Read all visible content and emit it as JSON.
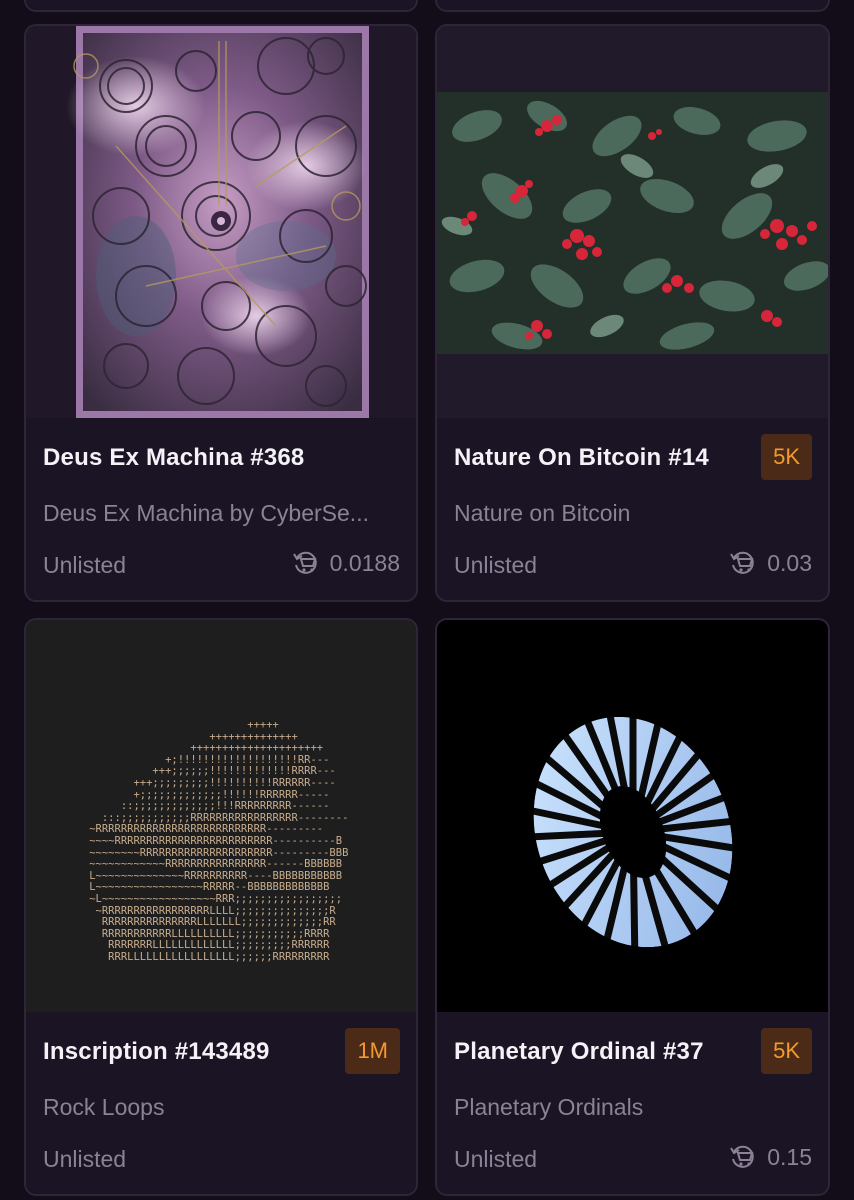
{
  "cards": [
    {
      "title": "Deus Ex Machina #368",
      "subtitle": "Deus Ex Machina by CyberSe...",
      "status": "Unlisted",
      "price": "0.0188",
      "badge": null,
      "image_icon": "steampunk-gears-artwork"
    },
    {
      "title": "Nature On Bitcoin #14",
      "subtitle": "Nature on Bitcoin",
      "status": "Unlisted",
      "price": "0.03",
      "badge": "5K",
      "image_icon": "red-flowers-foliage-artwork"
    },
    {
      "title": "Inscription #143489",
      "subtitle": "Rock Loops",
      "status": "Unlisted",
      "price": null,
      "badge": "1M",
      "image_icon": "ascii-art-artwork"
    },
    {
      "title": "Planetary Ordinal #37",
      "subtitle": "Planetary Ordinals",
      "status": "Unlisted",
      "price": "0.15",
      "badge": "5K",
      "image_icon": "striped-torus-artwork"
    }
  ],
  "colors": {
    "background": "#120d19",
    "card": "#1b1424",
    "badge_bg": "#4b2a17",
    "badge_text": "#f39a2d",
    "muted_text": "#8b8296"
  },
  "ascii_art": "                                   +++++\n                             ++++++++++++++\n                          +++++++++++++++++++++\n                      +;!!!!!!!!!!!!!!!!!!!RR---\n                    +++;;;;;;!!!!!!!!!!!!!RRRR---\n                 +++;;;;;;;;;!!!!!!!!!!RRRRRR----\n                 +;;;;;;;;;;;;;!!!!!!RRRRRR-----\n               ::;;;;;;;;;;;;;!!!RRRRRRRRR------\n            :::;;;;;;;;;;;RRRRRRRRRRRRRRRRR--------\n          ~RRRRRRRRRRRRRRRRRRRRRRRRRRR---------\n          ~~~~RRRRRRRRRRRRRRRRRRRRRRRRR----------B\n          ~~~~~~~~RRRRRRRRRRRRRRRRRRRRR---------BBB\n          ~~~~~~~~~~~~RRRRRRRRRRRRRRRR------BBBBBB\n          L~~~~~~~~~~~~~~RRRRRRRRRR----BBBBBBBBBBB\n          L~~~~~~~~~~~~~~~~~RRRRR--BBBBBBBBBBBBB\n          ~L~~~~~~~~~~~~~~~~~~RRR;;;;;;;;;;;;;;;;;\n           ~RRRRRRRRRRRRRRRRRLLLL;;;;;;;;;;;;;;;R\n            RRRRRRRRRRRRRRRLLLLLLL;;;;;;;;;;;;;RR\n            RRRRRRRRRRRLLLLLLLLLL;;;;;;;;;;;RRRR\n             RRRRRRRLLLLLLLLLLLLL;;;;;;;;;RRRRRR\n             RRRLLLLLLLLLLLLLLLLL;;;;;;RRRRRRRRR"
}
